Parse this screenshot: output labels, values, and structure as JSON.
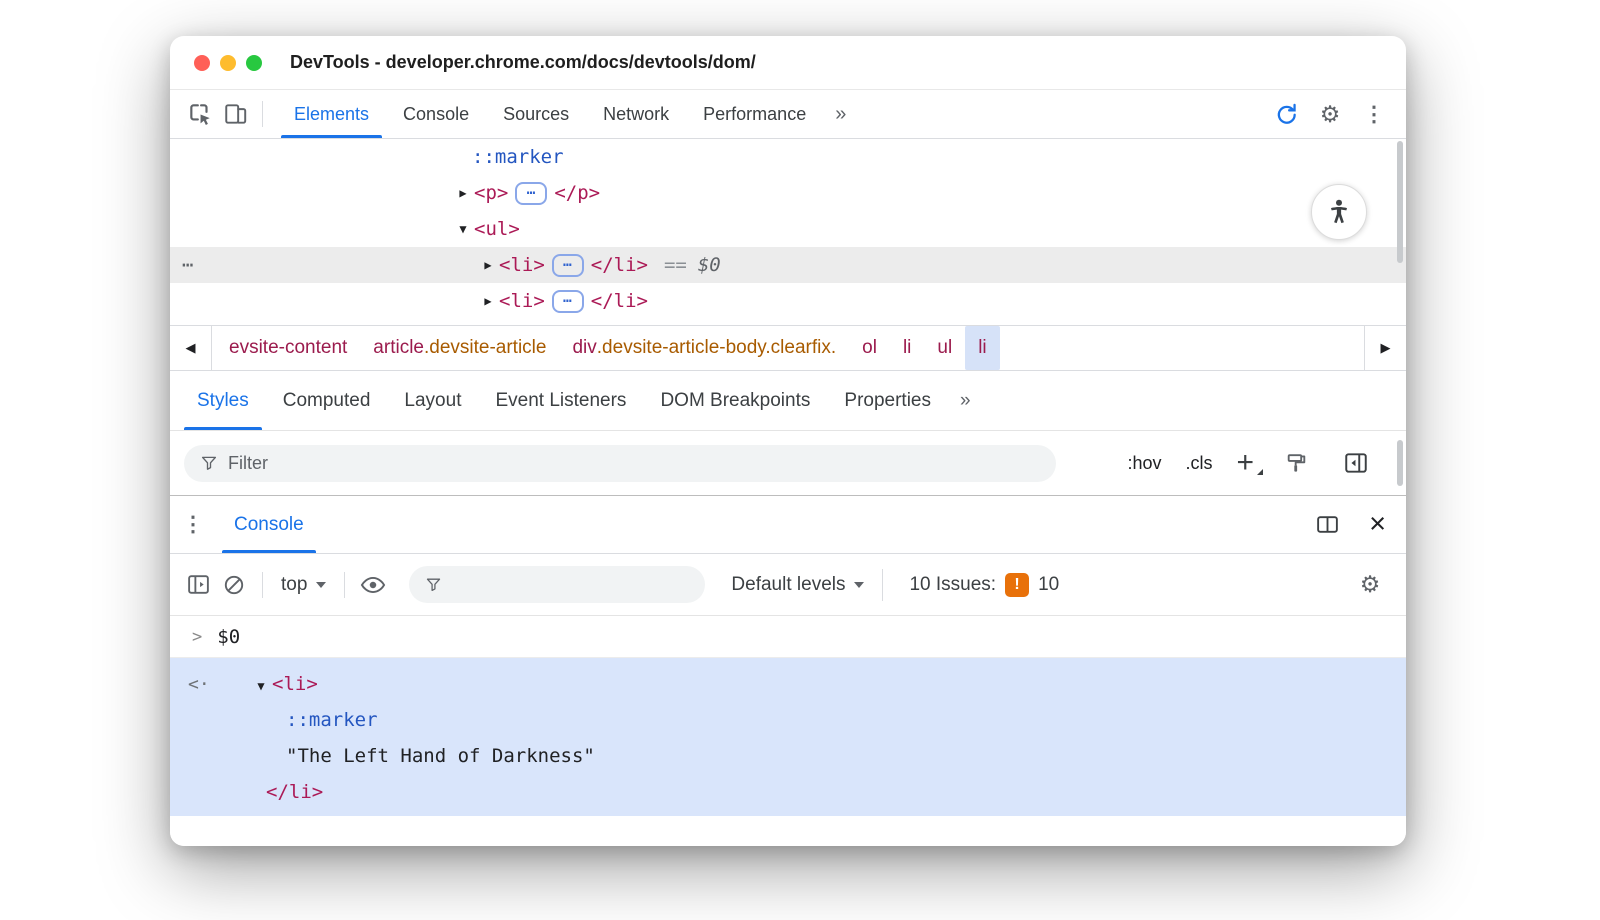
{
  "window": {
    "title": "DevTools - developer.chrome.com/docs/devtools/dom/"
  },
  "icons": {
    "caret_down": "▾",
    "back_arrow": "◀",
    "forward_arrow": "▶",
    "collapsed_arrow": "▶",
    "expanded_arrow": "▼",
    "overflow_chevrons": "»",
    "kebab": "⋮",
    "gear": "⚙",
    "close": "×",
    "node_ellipsis": "⋯",
    "gutter_ellipsis": "⋯",
    "return_arrow": "<·",
    "prompt_chevron": ">",
    "plus": "+"
  },
  "toolbar": {
    "tabs": [
      {
        "label": "Elements"
      },
      {
        "label": "Console"
      },
      {
        "label": "Sources"
      },
      {
        "label": "Network"
      },
      {
        "label": "Performance"
      }
    ]
  },
  "dom_tree": {
    "marker": "::marker",
    "p_open": "<p>",
    "p_close": "</p>",
    "ul_open": "<ul>",
    "li_open": "<li>",
    "li_close": "</li>",
    "selected_eq": "==",
    "selected_ref": "$0"
  },
  "breadcrumbs": {
    "items": [
      {
        "tag": "evsite-content",
        "cls": ""
      },
      {
        "tag": "article",
        "cls": ".devsite-article"
      },
      {
        "tag": "div",
        "cls": ".devsite-article-body.clearfix."
      },
      {
        "tag": "ol",
        "cls": ""
      },
      {
        "tag": "li",
        "cls": ""
      },
      {
        "tag": "ul",
        "cls": ""
      },
      {
        "tag": "li",
        "cls": ""
      }
    ]
  },
  "styles_panel": {
    "tabs": [
      {
        "label": "Styles"
      },
      {
        "label": "Computed"
      },
      {
        "label": "Layout"
      },
      {
        "label": "Event Listeners"
      },
      {
        "label": "DOM Breakpoints"
      },
      {
        "label": "Properties"
      }
    ],
    "filter_placeholder": "Filter",
    "hov_label": ":hov",
    "cls_label": ".cls"
  },
  "console": {
    "tab_label": "Console",
    "context_selector": "top",
    "levels_selector": "Default levels",
    "issues_label": "10 Issues:",
    "issues_badge": "!",
    "issues_count": "10",
    "history_expression": "$0",
    "result": {
      "li_open": "<li>",
      "marker": "::marker",
      "string": "\"The Left Hand of Darkness\"",
      "li_close": "</li>"
    }
  },
  "colors": {
    "accent_blue": "#1a73e8",
    "tag_color": "#ab1a56",
    "pseudo_color": "#2456c0",
    "class_color": "#a85b00",
    "issues_orange": "#e8710a",
    "selection_blue": "#d9e5fb"
  }
}
